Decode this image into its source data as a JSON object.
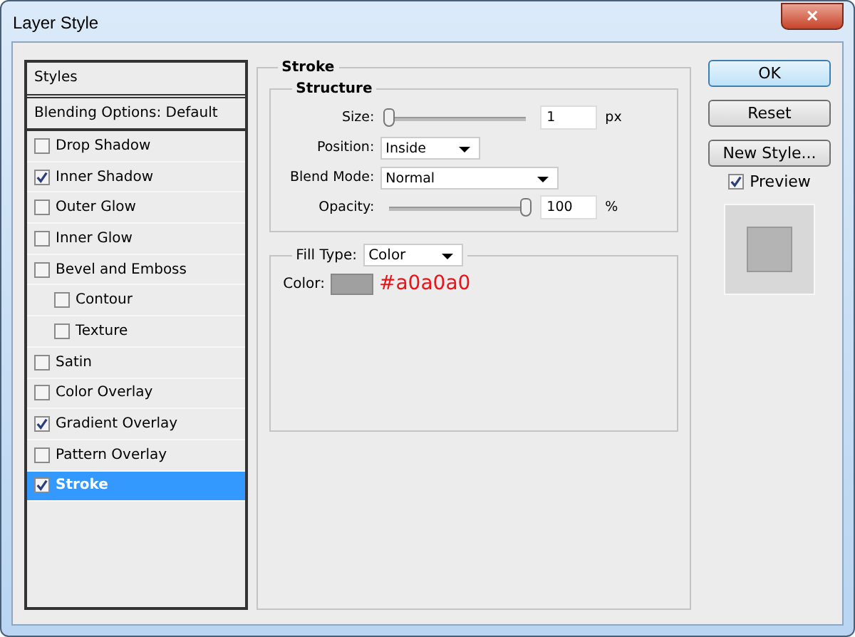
{
  "window": {
    "title": "Layer Style",
    "close": "✕"
  },
  "styles_panel": {
    "header": "Styles",
    "blending_options": "Blending Options: Default",
    "items": [
      {
        "label": "Drop Shadow",
        "checked": false,
        "selected": false
      },
      {
        "label": "Inner Shadow",
        "checked": true,
        "selected": false
      },
      {
        "label": "Outer Glow",
        "checked": false,
        "selected": false
      },
      {
        "label": "Inner Glow",
        "checked": false,
        "selected": false
      },
      {
        "label": "Bevel and Emboss",
        "checked": false,
        "selected": false,
        "children": [
          {
            "label": "Contour",
            "checked": false,
            "selected": false
          },
          {
            "label": "Texture",
            "checked": false,
            "selected": false
          }
        ]
      },
      {
        "label": "Satin",
        "checked": false,
        "selected": false
      },
      {
        "label": "Color Overlay",
        "checked": false,
        "selected": false
      },
      {
        "label": "Gradient Overlay",
        "checked": true,
        "selected": false
      },
      {
        "label": "Pattern Overlay",
        "checked": false,
        "selected": false
      },
      {
        "label": "Stroke",
        "checked": true,
        "selected": true
      }
    ]
  },
  "stroke": {
    "title": "Stroke",
    "structure": {
      "title": "Structure",
      "size": {
        "label": "Size:",
        "level": 0,
        "value": "1",
        "unit": "px"
      },
      "position": {
        "label": "Position:",
        "value": "Inside"
      },
      "blend_mode": {
        "label": "Blend Mode:",
        "value": "Normal"
      },
      "opacity": {
        "label": "Opacity:",
        "level": 1,
        "value": "100",
        "unit": "%"
      }
    },
    "fill": {
      "label": "Fill Type:",
      "value": "Color",
      "color_label": "Color:",
      "color": "#a0a0a0",
      "note": "#a0a0a0"
    }
  },
  "buttons": [
    {
      "label": "OK",
      "default": true
    },
    {
      "label": "Reset",
      "default": false
    },
    {
      "label": "New Style...",
      "default": false
    }
  ],
  "preview": {
    "label": "Preview",
    "checked": true
  }
}
